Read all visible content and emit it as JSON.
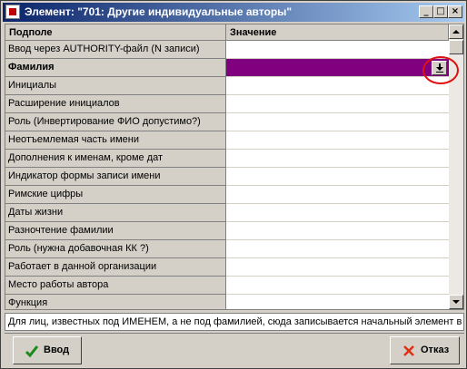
{
  "window": {
    "title": "Элемент: \"701: Другие индивидуальные авторы\"",
    "controls": {
      "minimize": "_",
      "maximize": "□",
      "close": "×"
    }
  },
  "grid": {
    "columns": [
      "Подполе",
      "Значение"
    ],
    "rows": [
      {
        "field": "Ввод через AUTHORITY-файл (N записи)",
        "value": ""
      },
      {
        "field": "Фамилия",
        "value": ""
      },
      {
        "field": "Инициалы",
        "value": ""
      },
      {
        "field": "Расширение инициалов",
        "value": ""
      },
      {
        "field": "Роль (Инвертирование ФИО допустимо?)",
        "value": ""
      },
      {
        "field": "Неотъемлемая часть имени",
        "value": ""
      },
      {
        "field": "Дополнения к именам, кроме дат",
        "value": ""
      },
      {
        "field": "Индикатор формы записи имени",
        "value": ""
      },
      {
        "field": "Римские цифры",
        "value": ""
      },
      {
        "field": "Даты жизни",
        "value": ""
      },
      {
        "field": "Разночтение фамилии",
        "value": ""
      },
      {
        "field": "Роль (нужна добавочная КК ?)",
        "value": ""
      },
      {
        "field": "Работает в данной организации",
        "value": ""
      },
      {
        "field": "Место работы автора",
        "value": ""
      },
      {
        "field": "Функция",
        "value": ""
      }
    ],
    "selected_row_index": 1,
    "selected_color": "#800080",
    "dropdown_icon": "download-arrow-icon",
    "annotation_color": "#e01010"
  },
  "hint": "Для лиц, известных под ИМЕНЕМ, а не под фамилией, сюда записывается начальный элемент в",
  "buttons": {
    "ok": {
      "label": "Ввод",
      "icon": "checkmark-icon",
      "icon_color": "#1a8a1a"
    },
    "cancel": {
      "label": "Отказ",
      "icon": "cross-icon",
      "icon_color": "#e03010"
    }
  }
}
